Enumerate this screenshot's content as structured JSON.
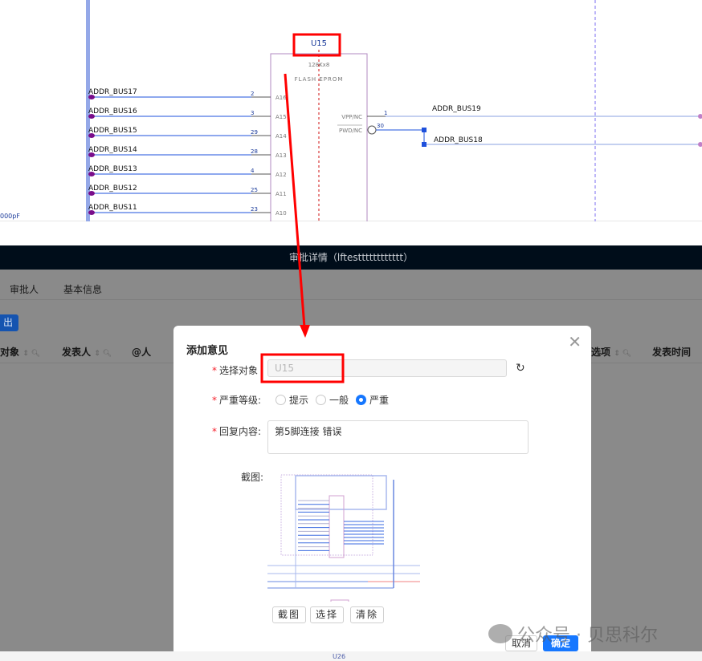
{
  "schematic": {
    "component_ref": "U15",
    "component_part": "128Kx8",
    "component_type": "FLASH EPROM",
    "left_label": "000pF",
    "left_nets": [
      {
        "net": "ADDR_BUS17",
        "pin": "2",
        "pin_name": "A16"
      },
      {
        "net": "ADDR_BUS16",
        "pin": "3",
        "pin_name": "A15"
      },
      {
        "net": "ADDR_BUS15",
        "pin": "29",
        "pin_name": "A14"
      },
      {
        "net": "ADDR_BUS14",
        "pin": "28",
        "pin_name": "A13"
      },
      {
        "net": "ADDR_BUS13",
        "pin": "4",
        "pin_name": "A12"
      },
      {
        "net": "ADDR_BUS12",
        "pin": "25",
        "pin_name": "A11"
      },
      {
        "net": "ADDR_BUS11",
        "pin": "23",
        "pin_name": "A10"
      }
    ],
    "right_pins": [
      {
        "pin_name": "VPP/NC",
        "pin": "1",
        "net": "ADDR_BUS19"
      },
      {
        "pin_name": "PWD/NC",
        "pin": "30",
        "net": "ADDR_BUS18"
      }
    ],
    "colors": {
      "wire": "#1e50dc",
      "pin": "#555555",
      "highlight": "#ff0000",
      "bus_port": "#7a0d8a"
    }
  },
  "window": {
    "title": "审批详情（lftestttttttttttt）"
  },
  "tabs": [
    {
      "label": "审批人"
    },
    {
      "label": "基本信息"
    }
  ],
  "export_button": "出",
  "table_headers": [
    {
      "label": "对象"
    },
    {
      "label": "发表人"
    },
    {
      "label": "@人"
    },
    {
      "label": "选项"
    },
    {
      "label": "发表时间"
    }
  ],
  "dialog": {
    "title": "添加意见",
    "target_label": "选择对象",
    "target_value": "U15",
    "severity_label": "严重等级:",
    "severity_options": [
      {
        "label": "提示",
        "checked": false
      },
      {
        "label": "一般",
        "checked": false
      },
      {
        "label": "严重",
        "checked": true
      }
    ],
    "reply_label": "回复内容:",
    "reply_value": "第5脚连接 错误",
    "screenshot_label": "截图:",
    "buttons": {
      "capture": "截图",
      "select": "选择",
      "clear": "清除",
      "cancel": "取消",
      "confirm": "确定"
    },
    "accent": "#1677ff"
  },
  "bottom_label": "U26",
  "watermark": "公众号 · 贝思科尔"
}
